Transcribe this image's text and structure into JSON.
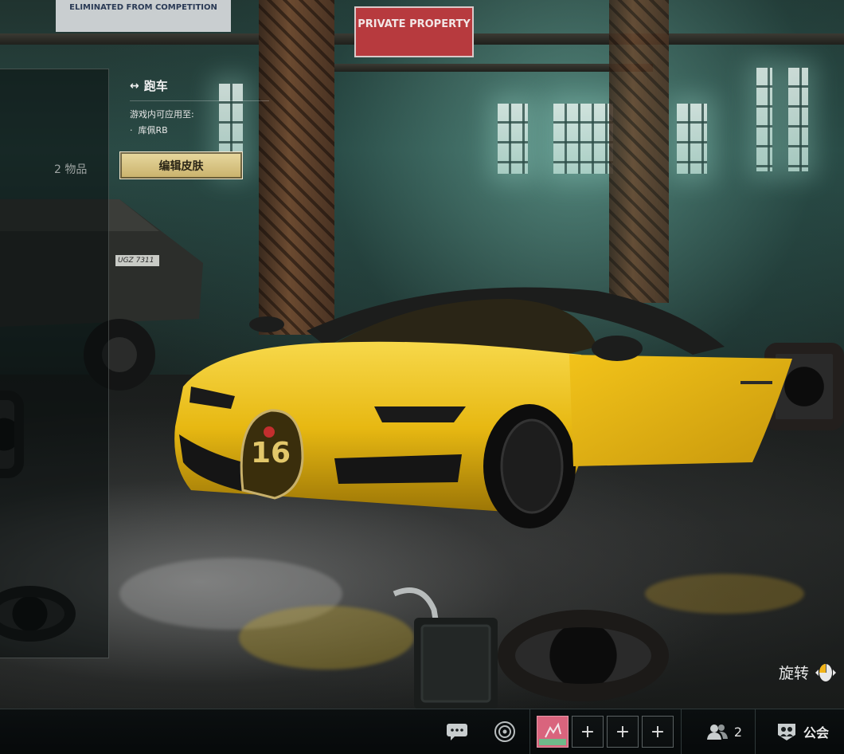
{
  "scene": {
    "signs": [
      "ELIMINATED FROM COMPETITION",
      "PRIVATE PROPERTY"
    ],
    "truck_plate": "UGZ 7311",
    "car_badge": "16"
  },
  "left_panel": {
    "item_count": "2 物品"
  },
  "info": {
    "category": "跑车",
    "applicable_label": "游戏内可应用至:",
    "applicable_items": [
      "库佩RB"
    ]
  },
  "edit_button": {
    "label": "编辑皮肤"
  },
  "rotate": {
    "label": "旋转"
  },
  "bottom_bar": {
    "chat_icon": "chat-icon",
    "radar_icon": "radar-icon",
    "avatar_icon": "player-avatar",
    "slots": [
      "+",
      "+",
      "+"
    ],
    "friends_count": "2",
    "guild_label": "公会"
  },
  "colors": {
    "accent_gold": "#d9c47f",
    "car_yellow": "#f2c31a",
    "avatar_bg": "#d9647d"
  }
}
